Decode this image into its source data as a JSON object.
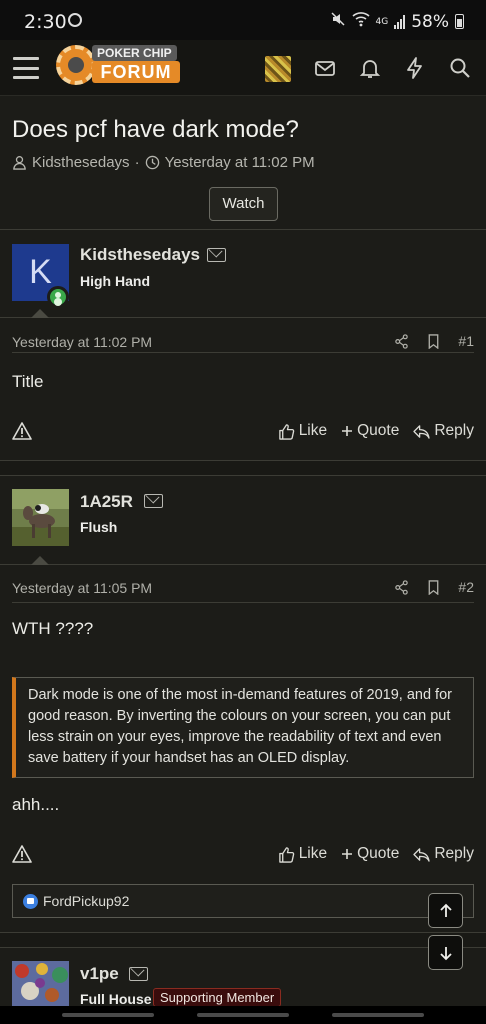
{
  "status_bar": {
    "time": "2:30",
    "network": "4G",
    "battery": "58%"
  },
  "header": {
    "logo_top": "POKER CHIP",
    "logo_bottom": "FORUM",
    "icons": [
      "menu-icon",
      "avatar",
      "inbox-icon",
      "bell-icon",
      "bolt-icon",
      "search-icon"
    ]
  },
  "thread": {
    "title": "Does pcf have dark mode?",
    "author": "Kidsthesedays",
    "separator": "·",
    "date": "Yesterday at 11:02 PM",
    "watch_label": "Watch"
  },
  "posts": [
    {
      "username": "Kidsthesedays",
      "avatar_letter": "K",
      "user_title": "High Hand",
      "date": "Yesterday at 11:02 PM",
      "number": "#1",
      "body": "Title",
      "actions": {
        "like": "Like",
        "quote": "Quote",
        "reply": "Reply"
      }
    },
    {
      "username": "1A25R",
      "user_title": "Flush",
      "date": "Yesterday at 11:05 PM",
      "number": "#2",
      "body": "WTH ????",
      "quote": "Dark mode is one of the most in-demand features of 2019, and for good reason. By inverting the colours on your screen, you can put less strain on your eyes, improve the readability of text and even save battery if your handset has an OLED display.",
      "after_quote": "ahh....",
      "actions": {
        "like": "Like",
        "quote": "Quote",
        "reply": "Reply"
      },
      "reaction_user": "FordPickup92"
    },
    {
      "username": "v1pe",
      "user_title": "Full House",
      "badge": "Supporting Member"
    }
  ],
  "colors": {
    "accent": "#e58a27",
    "quote_bar": "#d2771c",
    "background": "#1c1c18",
    "like": "#3b7fe0"
  }
}
